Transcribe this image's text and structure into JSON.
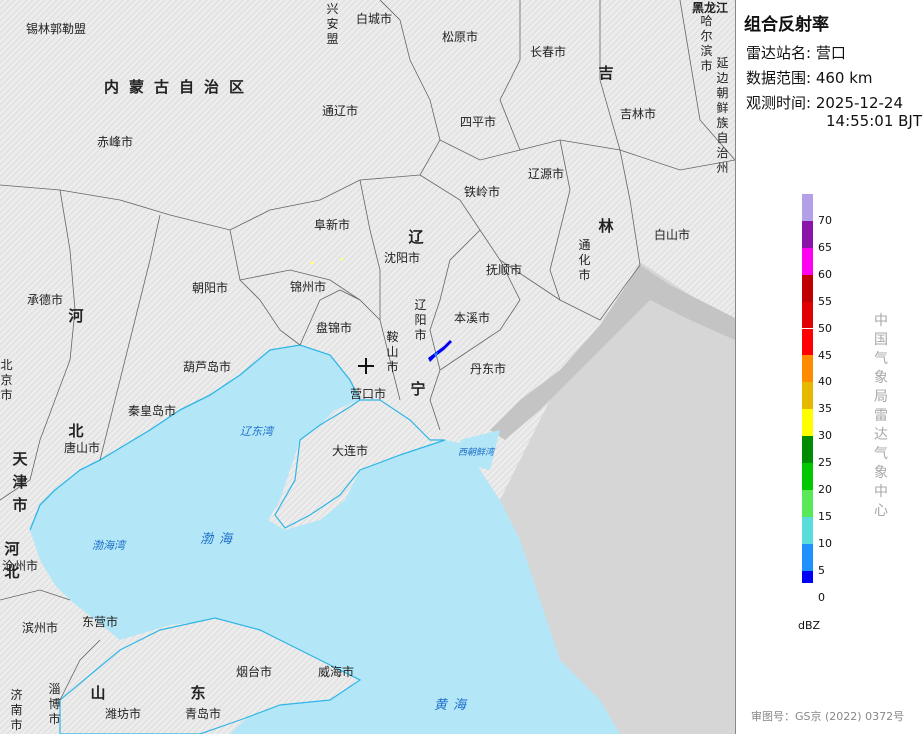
{
  "panel": {
    "title": "组合反射率",
    "station_label": "雷达站名:",
    "station_value": "营口",
    "range_label": "数据范围:",
    "range_value": "460 km",
    "time_label": "观测时间:",
    "time_date": "2025-12-24",
    "time_clock": "14:55:01 BJT",
    "unit": "dBZ",
    "vendor": "中国气象局雷达气象中心",
    "map_approval": "审图号：GS京 (2022) 0372号"
  },
  "legend": {
    "levels": [
      {
        "label": "70",
        "color": "#b3a0e6"
      },
      {
        "label": "65",
        "color": "#8b14a8"
      },
      {
        "label": "60",
        "color": "#ff00f0"
      },
      {
        "label": "55",
        "color": "#c00000"
      },
      {
        "label": "50",
        "color": "#e00000"
      },
      {
        "label": "45",
        "color": "#ff0000"
      },
      {
        "label": "40",
        "color": "#ff8c00"
      },
      {
        "label": "35",
        "color": "#e6b800"
      },
      {
        "label": "30",
        "color": "#ffff00"
      },
      {
        "label": "25",
        "color": "#008c00"
      },
      {
        "label": "20",
        "color": "#00c800"
      },
      {
        "label": "15",
        "color": "#58e858"
      },
      {
        "label": "10",
        "color": "#5adcdc"
      },
      {
        "label": "5",
        "color": "#2090ff"
      },
      {
        "label": "0",
        "color": "#0000f6"
      }
    ]
  },
  "map": {
    "colors": {
      "sea": "#b3e6f7",
      "land": "#ececec",
      "border": "#555555",
      "coast": "#2fb6e6",
      "outside": "#d6d6d6"
    },
    "provinces": {
      "neimenggu": "内蒙古自治区",
      "liaoning_1": "辽",
      "liaoning_2": "宁",
      "jilin_1": "吉",
      "jilin_2": "林",
      "hebei_1": "河",
      "hebei_2": "北",
      "heilongjiang": "黑龙江",
      "tianjin": "天津市",
      "hebei_left": "河北",
      "beijing": "北京市",
      "shandong_1": "山",
      "shandong_2": "东"
    },
    "cities": {
      "xilinguole": "锡林郭勒盟",
      "xinganmeng": "兴安盟",
      "baicheng": "白城市",
      "songyuan": "松原市",
      "changchun": "长春市",
      "harbin": "哈尔滨市",
      "yanbian": "延边朝鲜族自治州",
      "tongliao": "通辽市",
      "siping": "四平市",
      "jilin": "吉林市",
      "chifeng": "赤峰市",
      "liaoyuan": "辽源市",
      "tieling": "铁岭市",
      "fuxin": "阜新市",
      "shenyang": "沈阳市",
      "fushun": "抚顺市",
      "tonghua": "通化市",
      "baishan": "白山市",
      "chengde": "承德市",
      "chaoyang": "朝阳市",
      "jinzhou": "锦州市",
      "panjin": "盘锦市",
      "liaoyang": "辽阳市",
      "benxi": "本溪市",
      "anshan": "鞍山市",
      "huludao": "葫芦岛市",
      "dandong": "丹东市",
      "yingkou": "营口市",
      "qinhuangdao": "秦皇岛市",
      "tangshan": "唐山市",
      "dalian": "大连市",
      "cangzhou": "沧州市",
      "binzhou": "滨州市",
      "dongying": "东营市",
      "yantai": "烟台市",
      "weihai": "威海市",
      "jinan": "济南市",
      "zibo": "淄博市",
      "weifang": "潍坊市",
      "qingdao": "青岛市"
    },
    "seas": {
      "liaodong_bay": "辽东湾",
      "bohai_bay": "渤海湾",
      "bohai": "渤海",
      "yellow_sea": "黄海",
      "xichao_bay": "西朝鲜湾"
    }
  }
}
